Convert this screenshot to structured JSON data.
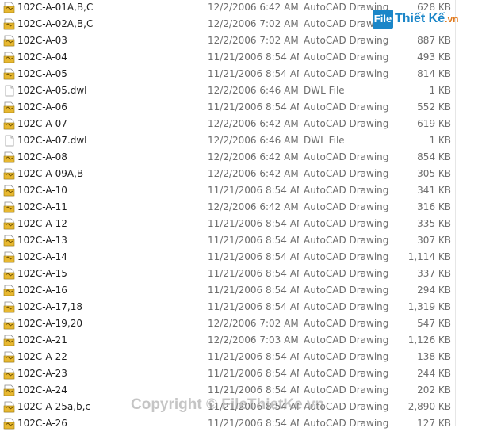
{
  "colors": {
    "folder_dwg": "#e8b830",
    "muted_text": "#6d6d6d",
    "watermark_blue": "#1b86c8"
  },
  "files": [
    {
      "name": "102C-A-01A,B,C",
      "date": "12/2/2006 6:42 AM",
      "type": "AutoCAD Drawing",
      "size": "628 KB",
      "icon": "dwg-file-icon"
    },
    {
      "name": "102C-A-02A,B,C",
      "date": "12/2/2006 7:02 AM",
      "type": "AutoCAD Drawing",
      "size": "",
      "icon": "dwg-file-icon"
    },
    {
      "name": "102C-A-03",
      "date": "12/2/2006 7:02 AM",
      "type": "AutoCAD Drawing",
      "size": "887 KB",
      "icon": "dwg-file-icon"
    },
    {
      "name": "102C-A-04",
      "date": "11/21/2006 8:54 AM",
      "type": "AutoCAD Drawing",
      "size": "493 KB",
      "icon": "dwg-file-icon"
    },
    {
      "name": "102C-A-05",
      "date": "11/21/2006 8:54 AM",
      "type": "AutoCAD Drawing",
      "size": "814 KB",
      "icon": "dwg-file-icon"
    },
    {
      "name": "102C-A-05.dwl",
      "date": "12/2/2006 6:46 AM",
      "type": "DWL File",
      "size": "1 KB",
      "icon": "blank-file-icon"
    },
    {
      "name": "102C-A-06",
      "date": "11/21/2006 8:54 AM",
      "type": "AutoCAD Drawing",
      "size": "552 KB",
      "icon": "dwg-file-icon"
    },
    {
      "name": "102C-A-07",
      "date": "12/2/2006 6:42 AM",
      "type": "AutoCAD Drawing",
      "size": "619 KB",
      "icon": "dwg-file-icon"
    },
    {
      "name": "102C-A-07.dwl",
      "date": "12/2/2006 6:46 AM",
      "type": "DWL File",
      "size": "1 KB",
      "icon": "blank-file-icon"
    },
    {
      "name": "102C-A-08",
      "date": "12/2/2006 6:42 AM",
      "type": "AutoCAD Drawing",
      "size": "854 KB",
      "icon": "dwg-file-icon"
    },
    {
      "name": "102C-A-09A,B",
      "date": "12/2/2006 6:42 AM",
      "type": "AutoCAD Drawing",
      "size": "305 KB",
      "icon": "dwg-file-icon"
    },
    {
      "name": "102C-A-10",
      "date": "11/21/2006 8:54 AM",
      "type": "AutoCAD Drawing",
      "size": "341 KB",
      "icon": "dwg-file-icon"
    },
    {
      "name": "102C-A-11",
      "date": "12/2/2006 6:42 AM",
      "type": "AutoCAD Drawing",
      "size": "316 KB",
      "icon": "dwg-file-icon"
    },
    {
      "name": "102C-A-12",
      "date": "11/21/2006 8:54 AM",
      "type": "AutoCAD Drawing",
      "size": "335 KB",
      "icon": "dwg-file-icon"
    },
    {
      "name": "102C-A-13",
      "date": "11/21/2006 8:54 AM",
      "type": "AutoCAD Drawing",
      "size": "307 KB",
      "icon": "dwg-file-icon"
    },
    {
      "name": "102C-A-14",
      "date": "11/21/2006 8:54 AM",
      "type": "AutoCAD Drawing",
      "size": "1,114 KB",
      "icon": "dwg-file-icon"
    },
    {
      "name": "102C-A-15",
      "date": "11/21/2006 8:54 AM",
      "type": "AutoCAD Drawing",
      "size": "337 KB",
      "icon": "dwg-file-icon"
    },
    {
      "name": "102C-A-16",
      "date": "11/21/2006 8:54 AM",
      "type": "AutoCAD Drawing",
      "size": "294 KB",
      "icon": "dwg-file-icon"
    },
    {
      "name": "102C-A-17,18",
      "date": "11/21/2006 8:54 AM",
      "type": "AutoCAD Drawing",
      "size": "1,319 KB",
      "icon": "dwg-file-icon"
    },
    {
      "name": "102C-A-19,20",
      "date": "12/2/2006 7:02 AM",
      "type": "AutoCAD Drawing",
      "size": "547 KB",
      "icon": "dwg-file-icon"
    },
    {
      "name": "102C-A-21",
      "date": "12/2/2006 7:03 AM",
      "type": "AutoCAD Drawing",
      "size": "1,126 KB",
      "icon": "dwg-file-icon"
    },
    {
      "name": "102C-A-22",
      "date": "11/21/2006 8:54 AM",
      "type": "AutoCAD Drawing",
      "size": "138 KB",
      "icon": "dwg-file-icon"
    },
    {
      "name": "102C-A-23",
      "date": "11/21/2006 8:54 AM",
      "type": "AutoCAD Drawing",
      "size": "244 KB",
      "icon": "dwg-file-icon"
    },
    {
      "name": "102C-A-24",
      "date": "11/21/2006 8:54 AM",
      "type": "AutoCAD Drawing",
      "size": "202 KB",
      "icon": "dwg-file-icon"
    },
    {
      "name": "102C-A-25a,b,c",
      "date": "11/21/2006 8:54 AM",
      "type": "AutoCAD Drawing",
      "size": "2,890 KB",
      "icon": "dwg-file-icon"
    },
    {
      "name": "102C-A-26",
      "date": "11/21/2006 8:54 AM",
      "type": "AutoCAD Drawing",
      "size": "127 KB",
      "icon": "dwg-file-icon"
    }
  ],
  "watermark": {
    "logo_text": "File",
    "brand_text": "Thiết Kế",
    "brand_tld": ".vn",
    "copyright": "Copyright © FileThietKe.vn"
  }
}
